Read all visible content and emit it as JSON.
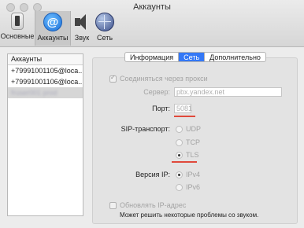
{
  "window": {
    "title": "Аккаунты"
  },
  "toolbar": {
    "general": "Основные",
    "accounts": "Аккаунты",
    "sound": "Звук",
    "network": "Сеть"
  },
  "accounts": {
    "header": "Аккаунты",
    "items": [
      "+79991001105@loca...",
      "+79991001106@loca...",
      "fruser001 prod"
    ]
  },
  "tabs": [
    "Информация",
    "Сеть",
    "Дополнительно"
  ],
  "network": {
    "proxy_label": "Соединяться через прокси",
    "server_label": "Сервер:",
    "server_placeholder": "pbx.yandex.net",
    "port_label": "Порт:",
    "port_placeholder": "5081",
    "sip_label": "SIP-транспорт:",
    "sip_options": [
      "UDP",
      "TCP",
      "TLS"
    ],
    "ip_label": "Версия IP:",
    "ip_options": [
      "IPv4",
      "IPv6"
    ],
    "update_ip_label": "Обновлять IP-адрес",
    "hint": "Может решить некоторые проблемы со звуком."
  },
  "colors": {
    "accent": "#3478f6",
    "annotation": "#e0493b"
  }
}
